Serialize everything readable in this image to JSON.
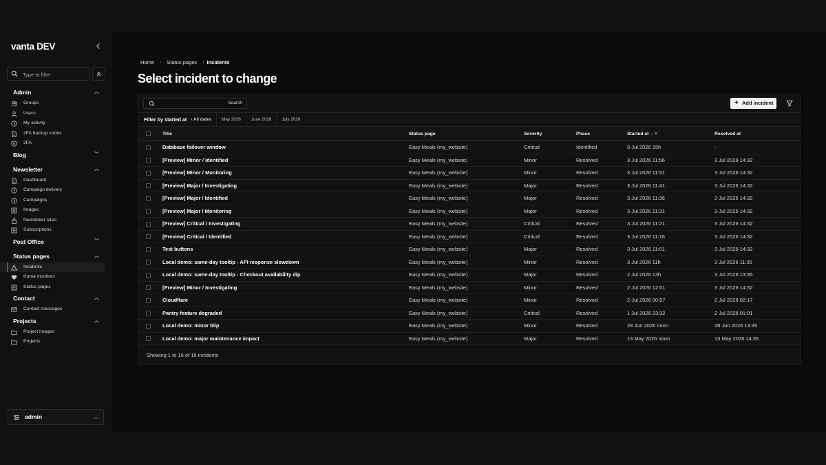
{
  "sidebar": {
    "brand": "vanta DEV",
    "filter_placeholder": "Type to filter",
    "sections": [
      {
        "label": "Admin",
        "chevron": "up",
        "items": [
          {
            "label": "Groups",
            "icon": "users-icon"
          },
          {
            "label": "Users",
            "icon": "user-icon"
          },
          {
            "label": "My activity",
            "icon": "clock-icon"
          },
          {
            "label": "2FA backup codes",
            "icon": "document-icon"
          },
          {
            "label": "2FA",
            "icon": "shield-icon"
          }
        ]
      },
      {
        "label": "Blog",
        "chevron": "down",
        "items": []
      },
      {
        "label": "Newsletter",
        "chevron": "up",
        "items": [
          {
            "label": "Dashboard",
            "icon": "document-icon"
          },
          {
            "label": "Campaign delivery",
            "icon": "clock-icon"
          },
          {
            "label": "Campaigns",
            "icon": "clock-icon"
          },
          {
            "label": "Images",
            "icon": "list-icon"
          },
          {
            "label": "Newsletter sites",
            "icon": "lock-icon"
          },
          {
            "label": "Subscriptions",
            "icon": "list-icon"
          }
        ]
      },
      {
        "label": "Post Office",
        "chevron": "down",
        "items": []
      },
      {
        "label": "Status pages",
        "chevron": "up",
        "items": [
          {
            "label": "Incidents",
            "icon": "warning-icon",
            "active": true
          },
          {
            "label": "Kuma monitors",
            "icon": "heart-icon"
          },
          {
            "label": "Status pages",
            "icon": "list-icon"
          }
        ]
      },
      {
        "label": "Contact",
        "chevron": "up",
        "items": [
          {
            "label": "Contact messages",
            "icon": "mail-icon"
          }
        ]
      },
      {
        "label": "Projects",
        "chevron": "up",
        "items": [
          {
            "label": "Project images",
            "icon": "folder-icon"
          },
          {
            "label": "Projects",
            "icon": "folder-icon"
          }
        ]
      }
    ],
    "user": "admin"
  },
  "breadcrumb": {
    "home": "Home",
    "section": "Status pages",
    "current": "Incidents"
  },
  "page_title": "Select incident to change",
  "toolbar": {
    "search_button": "Search",
    "add_button": "Add incident"
  },
  "filter_bar": {
    "label": "Filter by started at",
    "chips": [
      "‹ All dates",
      "May 2026",
      "June 2026",
      "July 2026"
    ]
  },
  "table": {
    "headers": {
      "title": "Title",
      "status_page": "Status page",
      "severity": "Severity",
      "phase": "Phase",
      "started_at": "Started at",
      "resolved_at": "Resolved at"
    },
    "rows": [
      {
        "title": "Database failover window",
        "status_page": "Easy Meals (my_website)",
        "severity": "Critical",
        "phase": "Identified",
        "started_at": "3 Jul 2026 15h",
        "resolved_at": "-"
      },
      {
        "title": "[Preview] Minor / Identified",
        "status_page": "Easy Meals (my_website)",
        "severity": "Minor",
        "phase": "Resolved",
        "started_at": "3 Jul 2026 11:56",
        "resolved_at": "3 Jul 2026 14:32"
      },
      {
        "title": "[Preview] Minor / Monitoring",
        "status_page": "Easy Meals (my_website)",
        "severity": "Minor",
        "phase": "Resolved",
        "started_at": "3 Jul 2026 11:51",
        "resolved_at": "3 Jul 2026 14:32"
      },
      {
        "title": "[Preview] Major / Investigating",
        "status_page": "Easy Meals (my_website)",
        "severity": "Major",
        "phase": "Resolved",
        "started_at": "3 Jul 2026 11:41",
        "resolved_at": "3 Jul 2026 14:32"
      },
      {
        "title": "[Preview] Major / Identified",
        "status_page": "Easy Meals (my_website)",
        "severity": "Major",
        "phase": "Resolved",
        "started_at": "3 Jul 2026 11:36",
        "resolved_at": "3 Jul 2026 14:32"
      },
      {
        "title": "[Preview] Major / Monitoring",
        "status_page": "Easy Meals (my_website)",
        "severity": "Major",
        "phase": "Resolved",
        "started_at": "3 Jul 2026 11:31",
        "resolved_at": "3 Jul 2026 14:32"
      },
      {
        "title": "[Preview] Critical / Investigating",
        "status_page": "Easy Meals (my_website)",
        "severity": "Critical",
        "phase": "Resolved",
        "started_at": "3 Jul 2026 11:21",
        "resolved_at": "3 Jul 2026 14:32"
      },
      {
        "title": "[Preview] Critical / Identified",
        "status_page": "Easy Meals (my_website)",
        "severity": "Critical",
        "phase": "Resolved",
        "started_at": "3 Jul 2026 11:16",
        "resolved_at": "3 Jul 2026 14:32"
      },
      {
        "title": "Test buttons",
        "status_page": "Easy Meals (my_website)",
        "severity": "Major",
        "phase": "Resolved",
        "started_at": "3 Jul 2026 11:01",
        "resolved_at": "3 Jul 2026 14:32"
      },
      {
        "title": "Local demo: same-day tooltip - API response slowdown",
        "status_page": "Easy Meals (my_website)",
        "severity": "Minor",
        "phase": "Resolved",
        "started_at": "3 Jul 2026 11h",
        "resolved_at": "3 Jul 2026 11:35"
      },
      {
        "title": "Local demo: same-day tooltip - Checkout availability dip",
        "status_page": "Easy Meals (my_website)",
        "severity": "Major",
        "phase": "Resolved",
        "started_at": "2 Jul 2026 13h",
        "resolved_at": "3 Jul 2026 13:35"
      },
      {
        "title": "[Preview] Minor / Investigating",
        "status_page": "Easy Meals (my_website)",
        "severity": "Minor",
        "phase": "Resolved",
        "started_at": "2 Jul 2026 12:01",
        "resolved_at": "3 Jul 2026 14:32"
      },
      {
        "title": "Cloudflare",
        "status_page": "Easy Meals (my_website)",
        "severity": "Minor",
        "phase": "Resolved",
        "started_at": "2 Jul 2026 00:57",
        "resolved_at": "2 Jul 2026 02:17"
      },
      {
        "title": "Pantry feature degraded",
        "status_page": "Easy Meals (my_website)",
        "severity": "Critical",
        "phase": "Resolved",
        "started_at": "1 Jul 2026 23:32",
        "resolved_at": "2 Jul 2026 01:01"
      },
      {
        "title": "Local demo: minor blip",
        "status_page": "Easy Meals (my_website)",
        "severity": "Minor",
        "phase": "Resolved",
        "started_at": "28 Jun 2026 noon",
        "resolved_at": "28 Jun 2026 13:35"
      },
      {
        "title": "Local demo: major maintenance impact",
        "status_page": "Easy Meals (my_website)",
        "severity": "Major",
        "phase": "Resolved",
        "started_at": "13 May 2026 noon",
        "resolved_at": "13 May 2026 14:35"
      }
    ],
    "footer": "Showing 1 to 16 of 16 incidents"
  },
  "colors": {
    "page_bg": "#111111",
    "main_bg": "#0b0b0b",
    "panel_bg": "#121212",
    "link": "#a8c4e0",
    "button_bg": "#f2f2f2"
  }
}
